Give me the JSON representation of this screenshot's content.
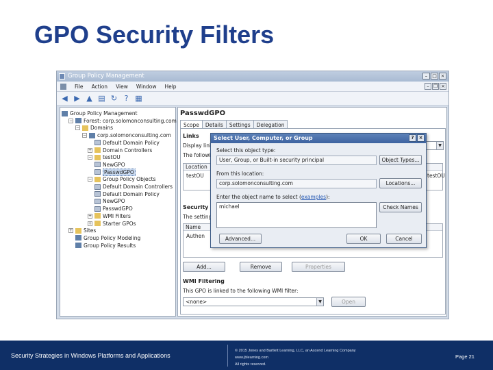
{
  "slide": {
    "title": "GPO Security Filters"
  },
  "window": {
    "title": "Group Policy Management",
    "menu": [
      "File",
      "Action",
      "View",
      "Window",
      "Help"
    ]
  },
  "tree": [
    {
      "label": "Group Policy Management",
      "exp": "",
      "icon": "domain"
    },
    {
      "label": "Forest: corp.solomonconsulting.com",
      "exp": "−",
      "icon": "domain"
    },
    {
      "label": "Domains",
      "exp": "−",
      "icon": "folder"
    },
    {
      "label": "corp.solomonconsulting.com",
      "exp": "−",
      "icon": "domain"
    },
    {
      "label": "Default Domain Policy",
      "exp": "",
      "icon": "gpo"
    },
    {
      "label": "Domain Controllers",
      "exp": "+",
      "icon": "folder"
    },
    {
      "label": "testOU",
      "exp": "−",
      "icon": "folder"
    },
    {
      "label": "NewGPO",
      "exp": "",
      "icon": "gpo"
    },
    {
      "label": "PasswdGPO",
      "exp": "",
      "icon": "gpo",
      "selected": true
    },
    {
      "label": "Group Policy Objects",
      "exp": "−",
      "icon": "folder"
    },
    {
      "label": "Default Domain Controllers",
      "exp": "",
      "icon": "gpo"
    },
    {
      "label": "Default Domain Policy",
      "exp": "",
      "icon": "gpo"
    },
    {
      "label": "NewGPO",
      "exp": "",
      "icon": "gpo"
    },
    {
      "label": "PasswdGPO",
      "exp": "",
      "icon": "gpo"
    },
    {
      "label": "WMI Filters",
      "exp": "+",
      "icon": "folder"
    },
    {
      "label": "Starter GPOs",
      "exp": "+",
      "icon": "folder"
    },
    {
      "label": "Sites",
      "exp": "+",
      "icon": "folder"
    },
    {
      "label": "Group Policy Modeling",
      "exp": "",
      "icon": "domain"
    },
    {
      "label": "Group Policy Results",
      "exp": "",
      "icon": "domain"
    }
  ],
  "gpo": {
    "title": "PasswdGPO",
    "tabs": [
      "Scope",
      "Details",
      "Settings",
      "Delegation"
    ],
    "links_heading": "Links",
    "display_links": "Display links",
    "following": "The following",
    "location_col": "Location",
    "location_row": "testOU",
    "link_row_right": "testOU",
    "security_heading": "Security Fi",
    "settings_text": "The settings",
    "name_col": "Name",
    "name_row": "Authen",
    "add_btn": "Add...",
    "remove_btn": "Remove",
    "properties_btn": "Properties",
    "wmi_heading": "WMI Filtering",
    "wmi_text": "This GPO is linked to the following WMI filter:",
    "wmi_value": "<none>",
    "open_btn": "Open"
  },
  "dialog": {
    "title": "Select User, Computer, or Group",
    "object_type_label": "Select this object type:",
    "object_type_value": "User, Group, or Built-in security principal",
    "object_types_btn": "Object Types...",
    "location_label": "From this location:",
    "location_value": "corp.solomonconsulting.com",
    "locations_btn": "Locations...",
    "enter_label": "Enter the object name to select",
    "examples_link": "examples",
    "name_value": "michael",
    "check_names_btn": "Check Names",
    "advanced_btn": "Advanced...",
    "ok_btn": "OK",
    "cancel_btn": "Cancel"
  },
  "footer": {
    "course": "Security Strategies in Windows Platforms and Applications",
    "copyright": "© 2015 Jones and Bartlett Learning, LLC, an Ascend Learning Company",
    "website": "www.jblearning.com",
    "rights": "All rights reserved.",
    "page": "Page 21"
  }
}
